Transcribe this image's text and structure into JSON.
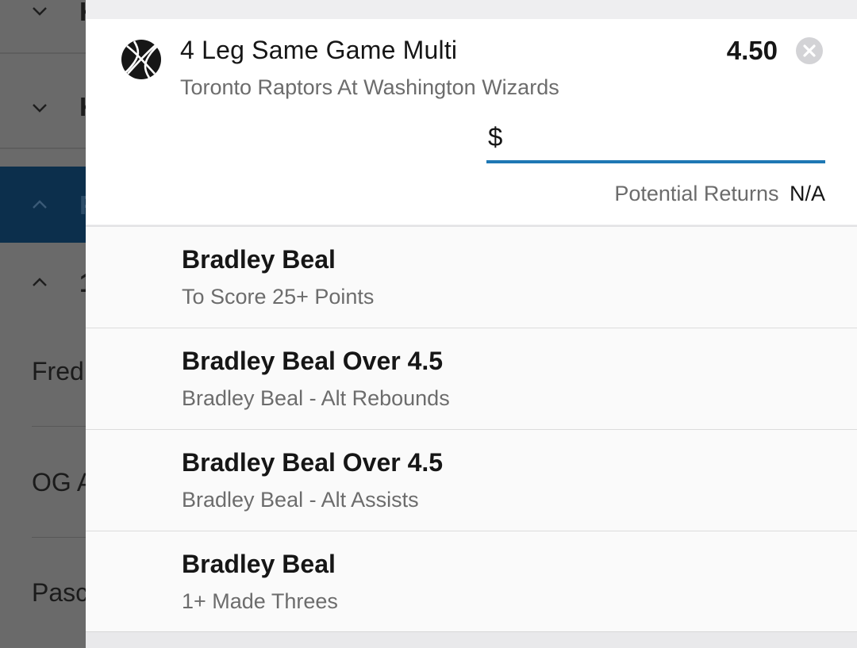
{
  "background": {
    "rows": [
      {
        "chevron": "chevron-down-icon",
        "peek": "K"
      },
      {
        "chevron": "chevron-down-icon",
        "peek": "K"
      },
      {
        "chevron": "chevron-up-icon",
        "peek": "P"
      },
      {
        "chevron": "chevron-up-icon",
        "peek": "1"
      }
    ],
    "players": [
      "Fred",
      "OG A",
      "Pasc"
    ]
  },
  "bet": {
    "sport_icon": "basketball-icon",
    "title": "4 Leg Same Game Multi",
    "odds": "4.50",
    "event": "Toronto Raptors At Washington Wizards",
    "stake": {
      "currency": "$",
      "value": "",
      "placeholder": ""
    },
    "returns_label": "Potential Returns",
    "returns_value": "N/A",
    "close_icon": "close-icon"
  },
  "legs": [
    {
      "title": "Bradley Beal",
      "subtitle": "To Score 25+ Points"
    },
    {
      "title": "Bradley Beal Over 4.5",
      "subtitle": "Bradley Beal - Alt Rebounds"
    },
    {
      "title": "Bradley Beal Over 4.5",
      "subtitle": "Bradley Beal - Alt Assists"
    },
    {
      "title": "Bradley Beal",
      "subtitle": "1+ Made Threes"
    }
  ],
  "colors": {
    "accent": "#1e78b4",
    "overlay": "#6a6a6a",
    "active_row": "#0c2f4c"
  }
}
